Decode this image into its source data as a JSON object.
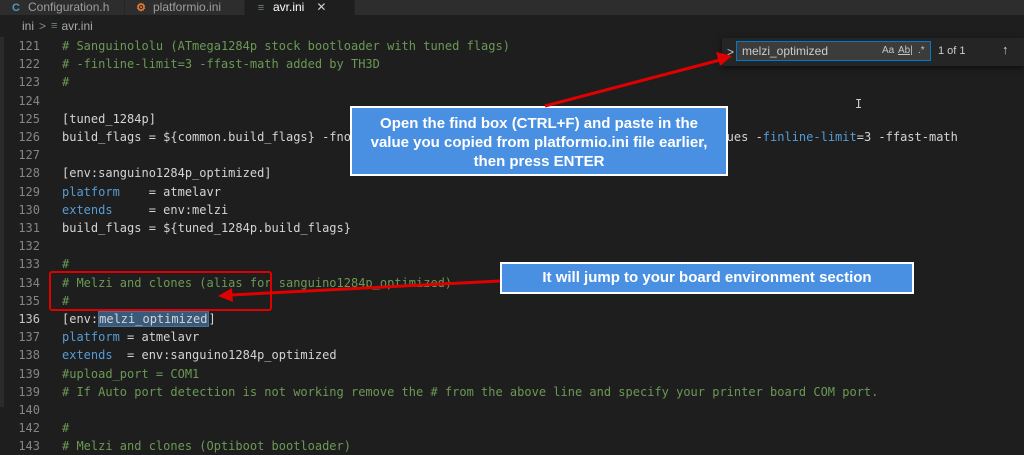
{
  "tabs": [
    {
      "icon_text": "C",
      "label": "Configuration.h",
      "active": false
    },
    {
      "icon_text": "⚙",
      "label": "platformio.ini",
      "active": false
    },
    {
      "icon_text": "≡",
      "label": "avr.ini",
      "active": true,
      "close": "✕"
    }
  ],
  "breadcrumb": {
    "folder": "ini",
    "separator": ">",
    "file": "avr.ini"
  },
  "editor": {
    "lines": [
      {
        "num": "121",
        "segments": [
          {
            "cls": "c",
            "text": "# Sanguinololu (ATmega1284p stock bootloader with tuned flags)"
          }
        ]
      },
      {
        "num": "122",
        "segments": [
          {
            "cls": "c",
            "text": "# -finline-limit=3 -ffast-math added by TH3D"
          }
        ]
      },
      {
        "num": "123",
        "segments": [
          {
            "cls": "c",
            "text": "#"
          }
        ]
      },
      {
        "num": "124",
        "segments": []
      },
      {
        "num": "125",
        "segments": [
          {
            "cls": "m",
            "text": "[tuned_1284p]"
          }
        ]
      },
      {
        "num": "126",
        "segments": [
          {
            "cls": "m",
            "text": "build_flags = ${common.build_flags} -fno-tre"
          },
          {
            "cls": "m",
            "text": "                                             logues -"
          },
          {
            "cls": "k",
            "text": "finline-limit"
          },
          {
            "cls": "m",
            "text": "=3 -ffast-math"
          }
        ]
      },
      {
        "num": "127",
        "segments": []
      },
      {
        "num": "128",
        "segments": [
          {
            "cls": "m",
            "text": "[env:sanguino1284p_optimized]"
          }
        ]
      },
      {
        "num": "129",
        "segments": [
          {
            "cls": "k",
            "text": "platform"
          },
          {
            "cls": "m",
            "text": "    = atmelavr"
          }
        ]
      },
      {
        "num": "130",
        "segments": [
          {
            "cls": "k",
            "text": "extends"
          },
          {
            "cls": "m",
            "text": "     = env:melzi"
          }
        ]
      },
      {
        "num": "131",
        "segments": [
          {
            "cls": "m",
            "text": "build_flags = ${tuned_1284p.build_flags}"
          }
        ]
      },
      {
        "num": "132",
        "segments": []
      },
      {
        "num": "133",
        "segments": [
          {
            "cls": "c",
            "text": "#"
          }
        ]
      },
      {
        "num": "134",
        "segments": [
          {
            "cls": "c",
            "text": "# Melzi and clones (alias for sanguino1284p_optimized)"
          }
        ]
      },
      {
        "num": "135",
        "segments": [
          {
            "cls": "c",
            "text": "#"
          }
        ]
      },
      {
        "num": "136",
        "segments": [
          {
            "cls": "m",
            "text": "[env:"
          },
          {
            "cls": "hl",
            "text": "melzi_optimized"
          },
          {
            "cls": "m",
            "text": "]"
          }
        ],
        "current": true
      },
      {
        "num": "137",
        "segments": [
          {
            "cls": "k",
            "text": "platform"
          },
          {
            "cls": "m",
            "text": " = atmelavr"
          }
        ]
      },
      {
        "num": "138",
        "segments": [
          {
            "cls": "k",
            "text": "extends"
          },
          {
            "cls": "m",
            "text": "  = env:sanguino1284p_optimized"
          }
        ]
      },
      {
        "num": "139",
        "segments": [
          {
            "cls": "c",
            "text": "#upload_port = COM1"
          }
        ]
      },
      {
        "num": "139b",
        "segments": [
          {
            "cls": "c",
            "text": "# If Auto port detection is not working remove the # from the above line and specify your printer board COM port."
          }
        ]
      },
      {
        "num": "140",
        "segments": []
      },
      {
        "num": "142",
        "segments": [
          {
            "cls": "c",
            "text": "#"
          }
        ]
      },
      {
        "num": "143",
        "segments": [
          {
            "cls": "c",
            "text": "# Melzi and clones (Optiboot bootloader)"
          }
        ]
      }
    ]
  },
  "find": {
    "chevron": ">",
    "query": "melzi_optimized",
    "match_case": "Aa",
    "whole_word": "Ab|",
    "regex": ".*",
    "results": "1 of 1",
    "prev": "↑"
  },
  "annotations": {
    "callout_find": "Open the find box (CTRL+F) and paste in the value you copied from platformio.ini file earlier, then press ENTER",
    "callout_jump": "It will jump to your board environment section",
    "arrow_color": "#e00000",
    "callout_color": "#4a90e2"
  }
}
